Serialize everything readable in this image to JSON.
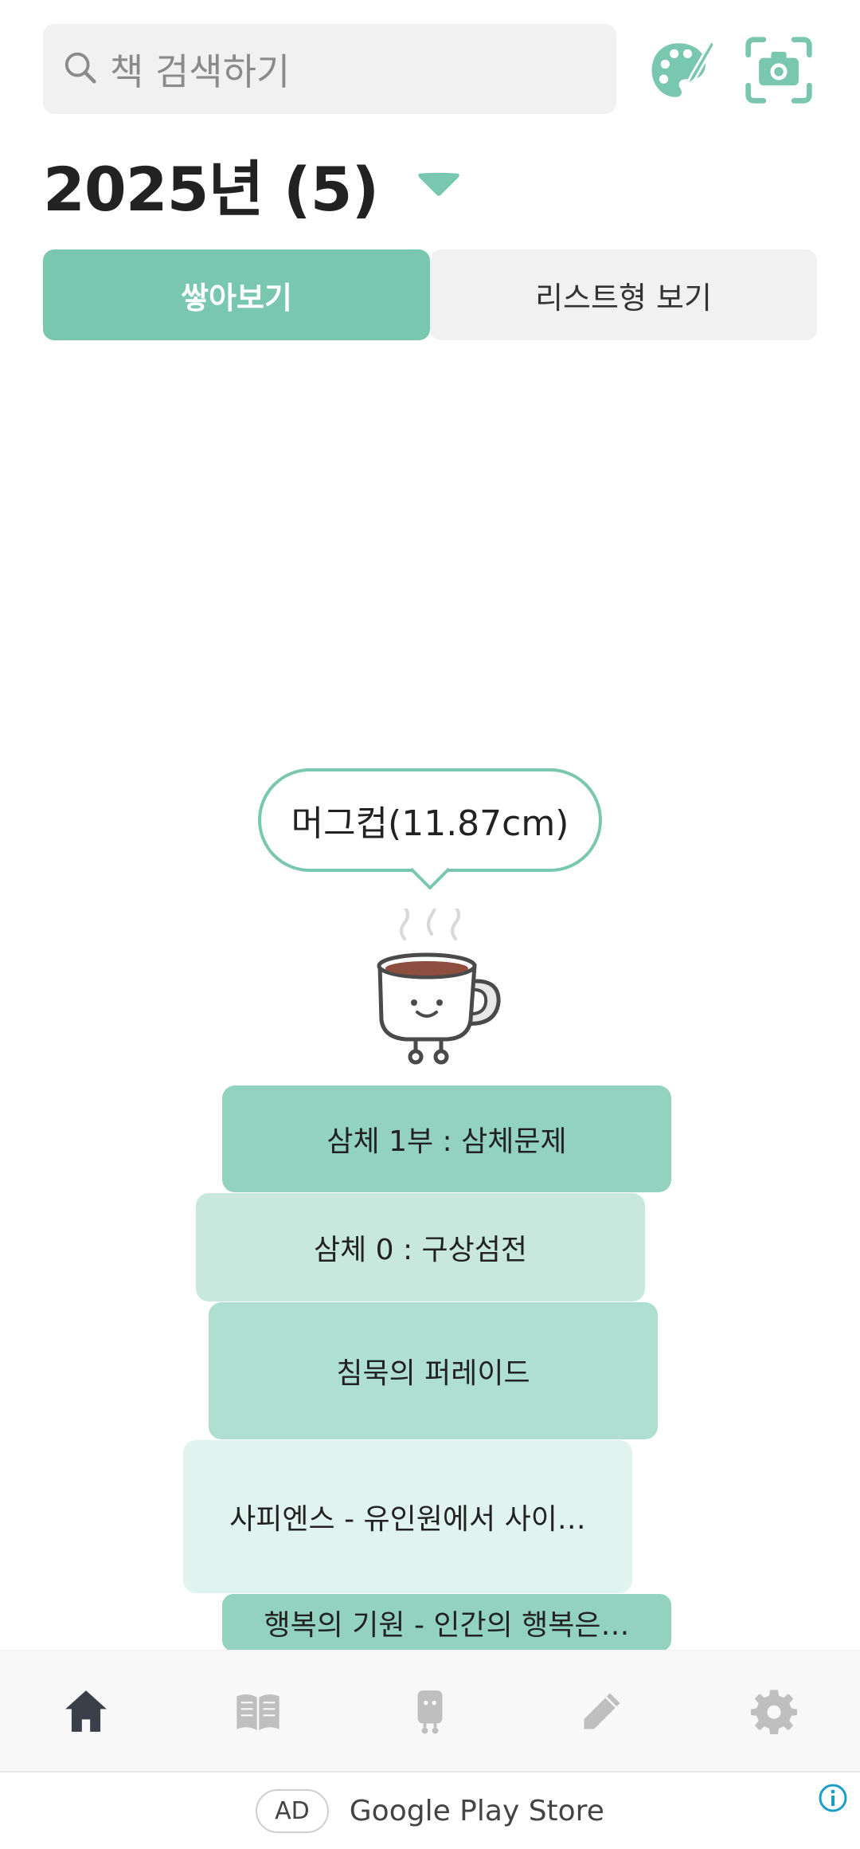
{
  "search": {
    "placeholder": "책 검색하기"
  },
  "icons": {
    "search": "search-icon",
    "palette": "palette-icon",
    "camera": "camera-scan-icon",
    "dropdown": "caret-down-icon"
  },
  "header": {
    "year_title": "2025년 (5)"
  },
  "view_toggle": {
    "stack_label": "쌓아보기",
    "list_label": "리스트형 보기",
    "selected": "stack"
  },
  "stack_height": {
    "label": "머그컵(11.87cm)"
  },
  "books": [
    {
      "title": "삼체 1부 : 삼체문제",
      "color": "#93d2bf"
    },
    {
      "title": "삼체 0 : 구상섬전",
      "color": "#c8e8de"
    },
    {
      "title": "침묵의 퍼레이드",
      "color": "#aedfd1"
    },
    {
      "title": "사피엔스 - 유인원에서 사이…",
      "color": "#e1f3ee"
    },
    {
      "title": "행복의 기원 - 인간의 행복은…",
      "color": "#93d2bf"
    }
  ],
  "bottom_nav": [
    {
      "icon": "home-icon",
      "active": true
    },
    {
      "icon": "book-open-icon",
      "active": false
    },
    {
      "icon": "character-icon",
      "active": false
    },
    {
      "icon": "pencil-icon",
      "active": false
    },
    {
      "icon": "gear-icon",
      "active": false
    }
  ],
  "ad": {
    "badge": "AD",
    "text": "Google Play Store"
  },
  "colors": {
    "accent": "#7ac7b0",
    "nav_active": "#3a3f4a",
    "nav_inactive": "#bfbfbf"
  }
}
